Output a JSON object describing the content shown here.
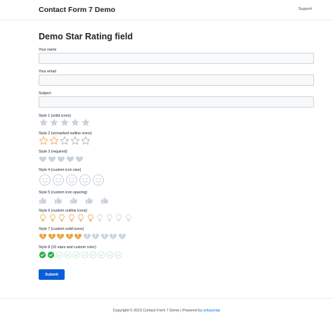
{
  "header": {
    "brand": "Contact Form 7 Demo",
    "support_link": "Support"
  },
  "page": {
    "title": "Demo Star Rating field"
  },
  "form": {
    "fields": [
      {
        "label": "Your name",
        "value": ""
      },
      {
        "label": "Your email",
        "value": ""
      },
      {
        "label": "Subject",
        "value": ""
      }
    ],
    "ratings": [
      {
        "label": "Style 1 (solid icons)",
        "icon": "star-solid",
        "count": 5,
        "selected": 0,
        "off_color": "#c9d3de",
        "on_color": "#f0ad4e"
      },
      {
        "label": "Style 2 (unmarked outline icons)",
        "icon": "star-outline",
        "count": 5,
        "selected": 2,
        "off_color": "#adb5bd",
        "on_color": "#f0ad4e"
      },
      {
        "label": "Style 3 (required)",
        "icon": "heart",
        "count": 5,
        "selected": 0,
        "off_color": "#c9d3de",
        "on_color": "#e8a33b"
      },
      {
        "label": "Style 4 (custom icon size)",
        "icon": "smiley",
        "count": 5,
        "selected": 0,
        "off_color": "#c9d3de",
        "on_color": "#f0ad4e"
      },
      {
        "label": "Style 5 (custom icon spacing)",
        "icon": "thumbs-up",
        "count": 5,
        "selected": 0,
        "off_color": "#c9d3de",
        "on_color": "#f0ad4e"
      },
      {
        "label": "Style 6 (custom outline icons)",
        "icon": "lightbulb",
        "count": 10,
        "selected": 6,
        "off_color": "#c9d3de",
        "on_color": "#e8a33b"
      },
      {
        "label": "Style 7 (custom solid icons)",
        "icon": "broken-heart",
        "count": 10,
        "selected": 5,
        "off_color": "#c9d3de",
        "on_color": "#e8a33b"
      },
      {
        "label": "Style 8 (10 stars and custom color)",
        "icon": "check-circle",
        "count": 10,
        "selected": 2,
        "off_color": "#b8e2c6",
        "on_color": "#22b14c"
      }
    ],
    "submit_label": "Submit"
  },
  "footer": {
    "text": "Copyright © 2023 Contact Form 7 Demo | Powered by ",
    "link_text": "unlayerwp"
  }
}
